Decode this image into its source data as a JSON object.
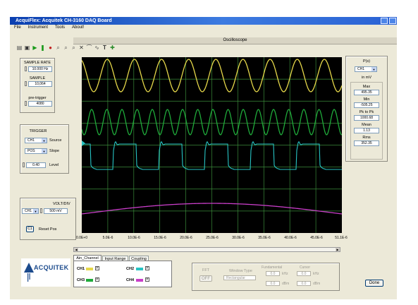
{
  "window": {
    "title": "AcquiFlex: Acquitek CH-3160 DAQ Board"
  },
  "menu": [
    "File",
    "Instrument",
    "Tools",
    "About!"
  ],
  "panel_title": "Oscilloscope",
  "toolbar_icons": [
    "print-icon",
    "save-icon",
    "play-icon",
    "step-icon",
    "stop-icon",
    "zoom-in-icon",
    "zoom-out-icon",
    "zoom-icon",
    "cross-icon",
    "measure-icon",
    "signal-icon",
    "text-icon",
    "marker-icon"
  ],
  "sampling": {
    "rate_label": "SAMPLE RATE",
    "rate_value": "10.000 Hz",
    "sample_label": "SAMPLE",
    "sample_value": "10,064",
    "pretrigger_label": "pre-trigger",
    "pretrigger_value": "4080"
  },
  "trigger": {
    "title": "TRIGGER",
    "source_value": "CH1",
    "source_label": "Source",
    "slope_value": "POS",
    "slope_label": "Slope",
    "level_value": "0.40",
    "level_label": "Level"
  },
  "volt": {
    "title": "VOLT/DIV",
    "channel_value": "CH1",
    "value": "500 mV",
    "reset_button": "C1",
    "reset_label": "Reset Pos"
  },
  "scope": {
    "x_ticks": [
      "0.0E+0",
      "5.0E-6",
      "10.0E-6",
      "15.0E-6",
      "20.0E-6",
      "25.0E-6",
      "30.0E-6",
      "35.0E-6",
      "40.0E-6",
      "45.0E-6",
      "51.1E-6"
    ]
  },
  "measure": {
    "title": "P(s)",
    "channel_value": "CH1",
    "unit": "in mV",
    "max_label": "Max",
    "max_value": "495.35",
    "min_label": "Min",
    "min_value": "-505.25",
    "pk_label": "Pk to Pk",
    "pk_value": "1000.68",
    "mean_label": "Mean",
    "mean_value": "1.13",
    "rms_label": "Rms",
    "rms_value": "352.35"
  },
  "tabs": [
    "Ain_Channel",
    "Input Range",
    "Coupling"
  ],
  "logo_text": "ACQUITEK",
  "channels": [
    {
      "label": "CH1",
      "color": "#e6d84a",
      "checked": "F"
    },
    {
      "label": "CH2",
      "color": "#27c4c4",
      "checked": "F"
    },
    {
      "label": "CH3",
      "color": "#1faa3a",
      "checked": "F"
    },
    {
      "label": "CH4",
      "color": "#c93ec9",
      "checked": "F"
    }
  ],
  "fft": {
    "fft_button": "FFT",
    "off_button": "OFF",
    "window_type_label": "Window Type",
    "window_type_value": "Rectangular",
    "fundamental_label": "Fundamental",
    "cursor_label": "Cursor",
    "f1_value": "0.0",
    "f1_unit": "kHz",
    "c1_value": "0.0",
    "c1_unit": "kHz",
    "f2_value": "0.0",
    "f2_unit": "dBm",
    "c2_value": "0.0",
    "c2_unit": "dBm"
  },
  "done_button": "Done",
  "colors": {
    "ch1": "#e6d84a",
    "ch2": "#27c4c4",
    "ch3": "#1faa3a",
    "ch4": "#c93ec9",
    "grid": "#3a8a3a",
    "screen": "#000000",
    "title_bar": "#0a3fb0"
  }
}
